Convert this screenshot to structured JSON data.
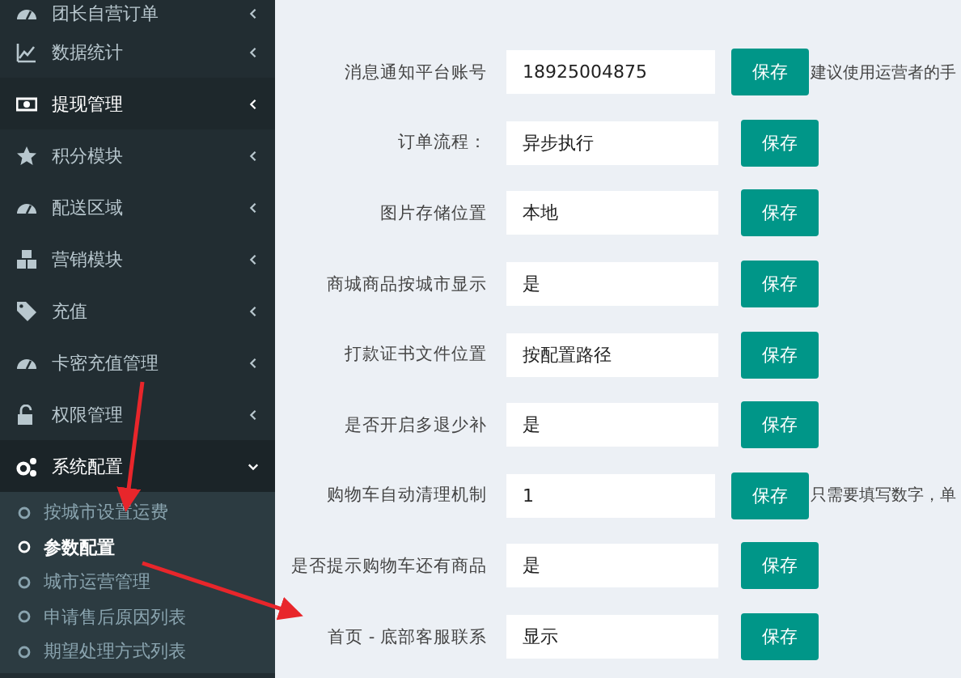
{
  "sidebar": {
    "items": [
      {
        "label": "团长自营订单",
        "kind": "gauge",
        "selected": false,
        "expanded": false
      },
      {
        "label": "数据统计",
        "kind": "chart",
        "selected": false,
        "expanded": false
      },
      {
        "label": "提现管理",
        "kind": "money",
        "selected": true,
        "expanded": false
      },
      {
        "label": "积分模块",
        "kind": "star",
        "selected": false,
        "expanded": false
      },
      {
        "label": "配送区域",
        "kind": "gauge",
        "selected": false,
        "expanded": false
      },
      {
        "label": "营销模块",
        "kind": "cubes",
        "selected": false,
        "expanded": false
      },
      {
        "label": "充值",
        "kind": "tag",
        "selected": false,
        "expanded": false
      },
      {
        "label": "卡密充值管理",
        "kind": "gauge",
        "selected": false,
        "expanded": false
      },
      {
        "label": "权限管理",
        "kind": "lock",
        "selected": false,
        "expanded": false
      },
      {
        "label": "系统配置",
        "kind": "cogs",
        "selected": false,
        "expanded": true,
        "children": [
          {
            "label": "按城市设置运费",
            "selected": false
          },
          {
            "label": "参数配置",
            "selected": true
          },
          {
            "label": "城市运营管理",
            "selected": false
          },
          {
            "label": "申请售后原因列表",
            "selected": false
          },
          {
            "label": "期望处理方式列表",
            "selected": false
          }
        ]
      }
    ]
  },
  "settings": [
    {
      "label": "消息通知平台账号",
      "value": "18925004875",
      "button": "保存",
      "hint": "建议使用运营者的手"
    },
    {
      "label": "订单流程：",
      "value": "异步执行",
      "button": "保存"
    },
    {
      "label": "图片存储位置",
      "value": "本地",
      "button": "保存"
    },
    {
      "label": "商城商品按城市显示",
      "value": "是",
      "button": "保存"
    },
    {
      "label": "打款证书文件位置",
      "value": "按配置路径",
      "button": "保存"
    },
    {
      "label": "是否开启多退少补",
      "value": "是",
      "button": "保存"
    },
    {
      "label": "购物车自动清理机制",
      "value": "1",
      "button": "保存",
      "hint": "只需要填写数字，单"
    },
    {
      "label": "是否提示购物车还有商品",
      "value": "是",
      "button": "保存"
    },
    {
      "label": "首页 - 底部客服联系",
      "value": "显示",
      "button": "保存"
    }
  ]
}
